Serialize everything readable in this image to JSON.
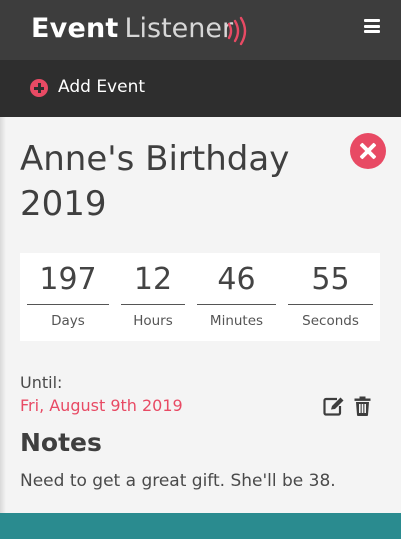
{
  "header": {
    "logo_event": "Event",
    "logo_listener": "Listener",
    "menu_icon": "hamburger-icon"
  },
  "toolbar": {
    "add_label": "Add Event",
    "add_icon": "plus-circle-icon"
  },
  "event": {
    "title": "Anne's Birthday 2019",
    "countdown": [
      {
        "value": "197",
        "label": "Days"
      },
      {
        "value": "12",
        "label": "Hours"
      },
      {
        "value": "46",
        "label": "Minutes"
      },
      {
        "value": "55",
        "label": "Seconds"
      }
    ],
    "until_label": "Until:",
    "until_date": "Fri, August 9th 2019",
    "notes_heading": "Notes",
    "notes_text": "Need to get a great gift. She'll be 38."
  },
  "colors": {
    "accent": "#e84a64",
    "topbar": "#3d3d3d",
    "addbar": "#2e2e2e",
    "background": "#f4f4f4",
    "footer": "#2a8b8f"
  }
}
